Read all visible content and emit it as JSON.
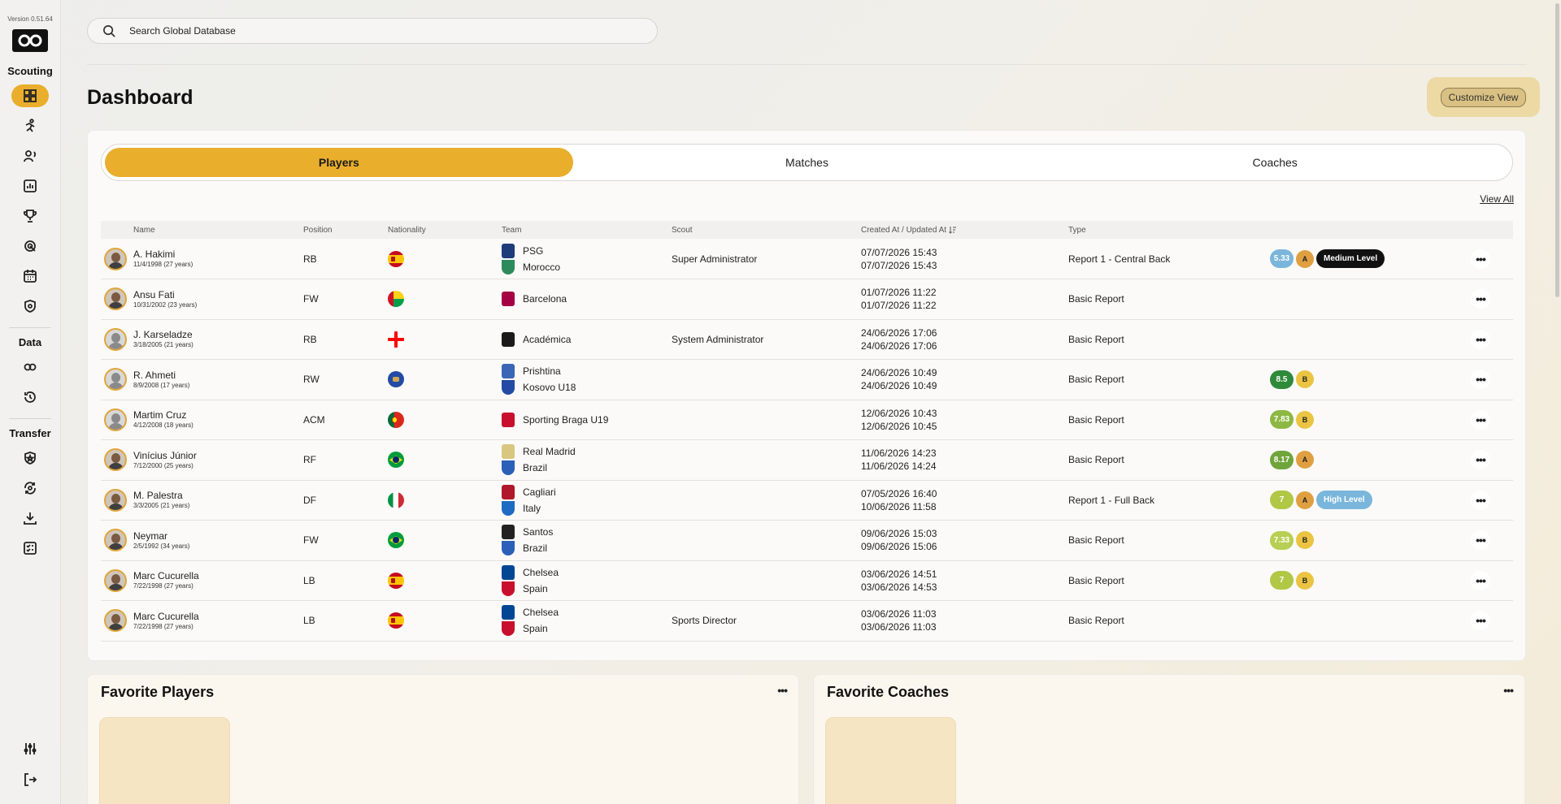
{
  "app": {
    "version": "Version 0.51.64"
  },
  "sidebar": {
    "sections": [
      {
        "label": "Scouting",
        "items": [
          "dashboard-icon",
          "player-icon",
          "scout-icon",
          "reports-icon",
          "trophy-icon",
          "target-icon",
          "calendar-icon",
          "shield-icon"
        ]
      },
      {
        "label": "Data",
        "items": [
          "data-icon",
          "history-icon"
        ]
      },
      {
        "label": "Transfer",
        "items": [
          "transfer-shield-icon",
          "exchange-icon",
          "upload-icon",
          "checklist-icon"
        ]
      }
    ],
    "bottom_items": [
      "settings-icon",
      "logout-icon"
    ],
    "active": "dashboard-icon"
  },
  "search": {
    "placeholder": "Search Global Database",
    "value": ""
  },
  "header": {
    "title": "Dashboard",
    "customize_label": "Customize View"
  },
  "tabs": [
    {
      "label": "Players",
      "active": true
    },
    {
      "label": "Matches",
      "active": false
    },
    {
      "label": "Coaches",
      "active": false
    }
  ],
  "view_all_label": "View All",
  "table": {
    "columns": [
      "Name",
      "Position",
      "Nationality",
      "Team",
      "Scout",
      "Created At / Updated At",
      "Type"
    ],
    "rows": [
      {
        "name": "A. Hakimi",
        "dob": "11/4/1998 (27 years)",
        "position": "RB",
        "flag": "spain",
        "teams": [
          "PSG",
          "Morocco"
        ],
        "scout": "Super Administrator",
        "created": "07/07/2026 15:43",
        "updated": "07/07/2026 15:43",
        "type": "Report 1 - Central Back",
        "score": "5.33",
        "score_color": "#7ab6dc",
        "grade": "A",
        "level": "Medium Level",
        "level_color": "#111111",
        "avatar": "photo"
      },
      {
        "name": "Ansu Fati",
        "dob": "10/31/2002 (23 years)",
        "position": "FW",
        "flag": "guinea-bissau",
        "teams": [
          "Barcelona"
        ],
        "scout": "",
        "created": "01/07/2026 11:22",
        "updated": "01/07/2026 11:22",
        "type": "Basic Report",
        "score": "",
        "grade": "",
        "level": "",
        "avatar": "photo"
      },
      {
        "name": "J. Karseladze",
        "dob": "3/18/2005 (21 years)",
        "position": "RB",
        "flag": "georgia",
        "teams": [
          "Académica"
        ],
        "scout": "System Administrator",
        "created": "24/06/2026 17:06",
        "updated": "24/06/2026 17:06",
        "type": "Basic Report",
        "score": "",
        "grade": "",
        "level": "",
        "avatar": "placeholder"
      },
      {
        "name": "R. Ahmeti",
        "dob": "8/9/2008 (17 years)",
        "position": "RW",
        "flag": "kosovo",
        "teams": [
          "Prishtina",
          "Kosovo U18"
        ],
        "scout": "",
        "created": "24/06/2026 10:49",
        "updated": "24/06/2026 10:49",
        "type": "Basic Report",
        "score": "8.5",
        "score_color": "#2f8a3a",
        "grade": "B",
        "level": "",
        "avatar": "placeholder"
      },
      {
        "name": "Martim Cruz",
        "dob": "4/12/2008 (18 years)",
        "position": "ACM",
        "flag": "portugal",
        "teams": [
          "Sporting Braga U19"
        ],
        "scout": "",
        "created": "12/06/2026 10:43",
        "updated": "12/06/2026 10:45",
        "type": "Basic Report",
        "score": "7.83",
        "score_color": "#8db843",
        "grade": "B",
        "level": "",
        "avatar": "placeholder"
      },
      {
        "name": "Vinícius Júnior",
        "dob": "7/12/2000 (25 years)",
        "position": "RF",
        "flag": "brazil",
        "teams": [
          "Real Madrid",
          "Brazil"
        ],
        "scout": "",
        "created": "11/06/2026 14:23",
        "updated": "11/06/2026 14:24",
        "type": "Basic Report",
        "score": "8.17",
        "score_color": "#6fa53b",
        "grade": "A",
        "level": "",
        "avatar": "photo"
      },
      {
        "name": "M. Palestra",
        "dob": "3/3/2005 (21 years)",
        "position": "DF",
        "flag": "italy",
        "teams": [
          "Cagliari",
          "Italy"
        ],
        "scout": "",
        "created": "07/05/2026 16:40",
        "updated": "10/06/2026 11:58",
        "type": "Report 1 - Full Back",
        "score": "7",
        "score_color": "#b0c845",
        "grade": "A",
        "level": "High Level",
        "level_color": "#7ab6dc",
        "avatar": "photo"
      },
      {
        "name": "Neymar",
        "dob": "2/5/1992 (34 years)",
        "position": "FW",
        "flag": "brazil",
        "teams": [
          "Santos",
          "Brazil"
        ],
        "scout": "",
        "created": "09/06/2026 15:03",
        "updated": "09/06/2026 15:06",
        "type": "Basic Report",
        "score": "7.33",
        "score_color": "#b7cf52",
        "grade": "B",
        "level": "",
        "avatar": "photo"
      },
      {
        "name": "Marc Cucurella",
        "dob": "7/22/1998 (27 years)",
        "position": "LB",
        "flag": "spain",
        "teams": [
          "Chelsea",
          "Spain"
        ],
        "scout": "",
        "created": "03/06/2026 14:51",
        "updated": "03/06/2026 14:53",
        "type": "Basic Report",
        "score": "7",
        "score_color": "#b0c845",
        "grade": "B",
        "level": "",
        "avatar": "photo"
      },
      {
        "name": "Marc Cucurella",
        "dob": "7/22/1998 (27 years)",
        "position": "LB",
        "flag": "spain",
        "teams": [
          "Chelsea",
          "Spain"
        ],
        "scout": "Sports Director",
        "created": "03/06/2026 11:03",
        "updated": "03/06/2026 11:03",
        "type": "Basic Report",
        "score": "",
        "grade": "",
        "level": "",
        "avatar": "photo"
      }
    ]
  },
  "favorites": {
    "players_title": "Favorite Players",
    "coaches_title": "Favorite Coaches"
  },
  "colors": {
    "accent": "#e9ae2b",
    "grade_a": "#e0a041",
    "grade_b": "#ecc443"
  }
}
